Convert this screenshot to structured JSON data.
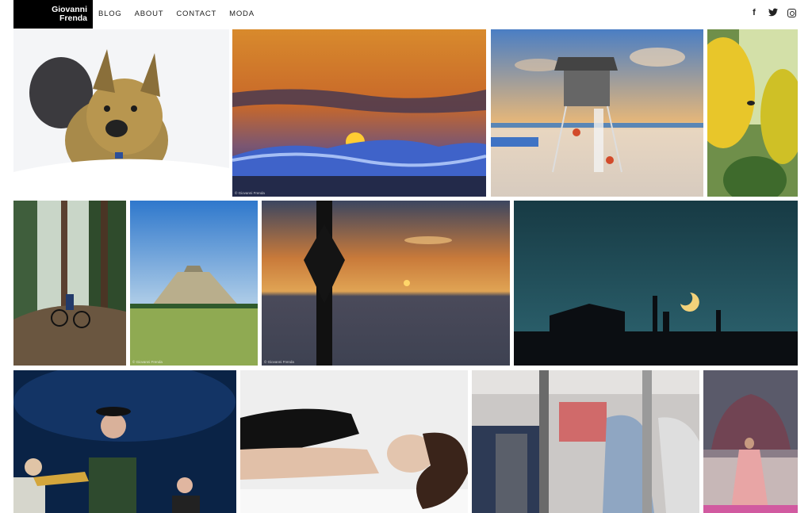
{
  "logo": {
    "line1": "Giovanni",
    "line2": "Frenda"
  },
  "nav": [
    {
      "label": "BLOG"
    },
    {
      "label": "ABOUT"
    },
    {
      "label": "CONTACT"
    },
    {
      "label": "MODA"
    }
  ],
  "social": [
    {
      "icon": "facebook-icon",
      "glyph": "f"
    },
    {
      "icon": "twitter-icon",
      "glyph": "🐦"
    },
    {
      "icon": "instagram-icon",
      "glyph": ""
    }
  ],
  "credit": "© Giovanni Frenda",
  "photos": [
    {
      "name": "photo-dog-in-snow"
    },
    {
      "name": "photo-sunset-wave"
    },
    {
      "name": "photo-lifeguard-tower"
    },
    {
      "name": "photo-sunflower-bee"
    },
    {
      "name": "photo-mountain-biker"
    },
    {
      "name": "photo-chichen-itza"
    },
    {
      "name": "photo-sea-sunset-buoy"
    },
    {
      "name": "photo-night-moon-silhouette"
    },
    {
      "name": "photo-concert-musicians"
    },
    {
      "name": "photo-reclining-woman"
    },
    {
      "name": "photo-clothing-store"
    },
    {
      "name": "photo-fashion-runway"
    }
  ]
}
